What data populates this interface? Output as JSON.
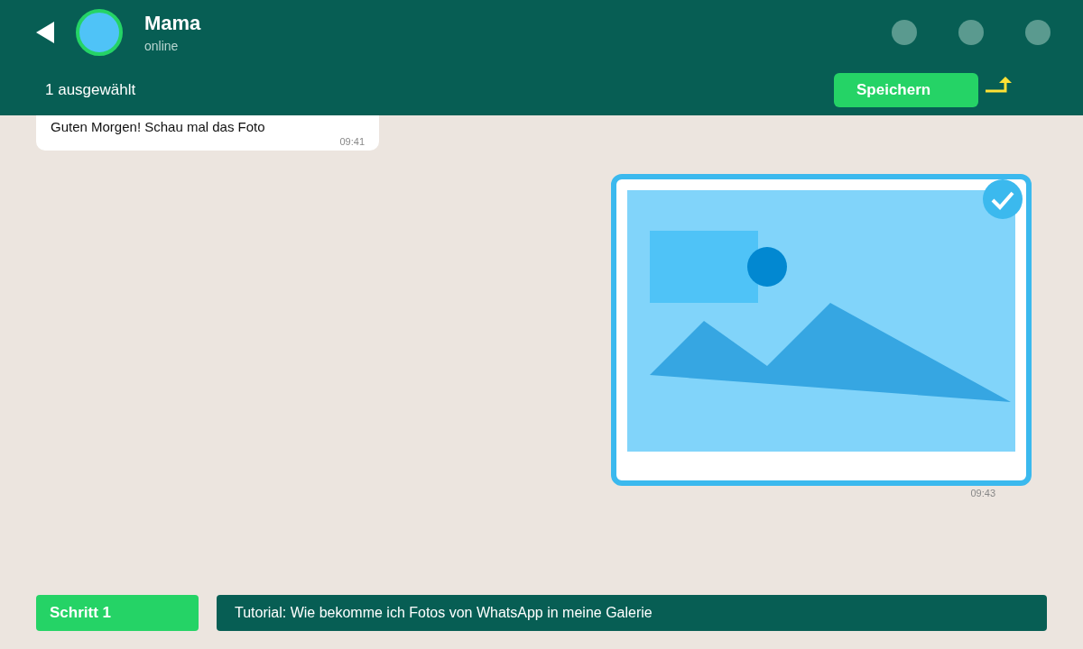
{
  "header": {
    "contact_name": "Mama",
    "status": "online"
  },
  "selection_bar": {
    "count_label": "1 ausgewählt",
    "save_button": "Speichern"
  },
  "messages": [
    {
      "kind": "text",
      "text": "Guten Morgen! Schau mal das Foto",
      "time": "09:41",
      "selected": false
    },
    {
      "kind": "image",
      "time": "09:43",
      "selected": true
    }
  ],
  "footer": {
    "step": "Schritt 1",
    "caption": "Tutorial: Wie bekomme ich Fotos von WhatsApp in meine Galerie"
  }
}
